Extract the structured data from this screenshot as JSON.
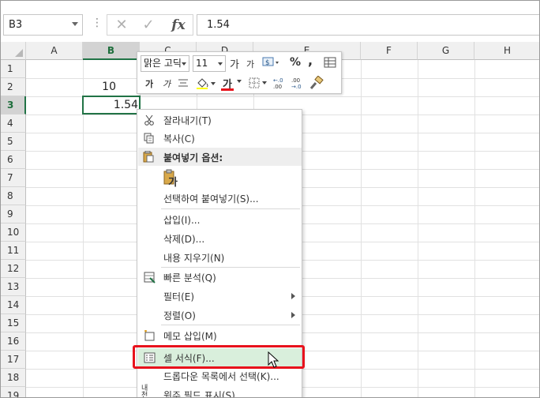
{
  "formula_bar": {
    "name_box": "B3",
    "dots": "⋮",
    "cancel_glyph": "✕",
    "enter_glyph": "✓",
    "fx_label": "fx",
    "formula_value": "1.54"
  },
  "grid": {
    "columns": [
      "A",
      "B",
      "C",
      "D",
      "E",
      "F",
      "G",
      "H"
    ],
    "rows": [
      "1",
      "2",
      "3",
      "4",
      "5",
      "6",
      "7",
      "8",
      "9",
      "10",
      "11",
      "12",
      "13",
      "14",
      "15",
      "16",
      "17",
      "18",
      "19"
    ],
    "selected_column": "B",
    "selected_row": "3",
    "cell_b2": "10",
    "cell_b3": "1.54"
  },
  "mini_toolbar": {
    "font_name": "맑은 고딕",
    "font_size": "11",
    "grow_font": "가",
    "shrink_font": "가",
    "percent": "%",
    "comma": ",",
    "bold": "가",
    "italic": "가",
    "font_color_glyph": "가",
    "inc_decimal": "←.0 .00",
    "dec_decimal": ".00 →.0"
  },
  "context_menu": {
    "cut": "잘라내기(T)",
    "copy": "복사(C)",
    "paste_options": "붙여넣기 옵션:",
    "paste_glyph": "가",
    "paste_special": "선택하여 붙여넣기(S)...",
    "insert": "삽입(I)...",
    "delete": "삭제(D)...",
    "clear_contents": "내용 지우기(N)",
    "quick_analysis": "빠른 분석(Q)",
    "filter": "필터(E)",
    "sort": "정렬(O)",
    "insert_comment": "메모 삽입(M)",
    "format_cells": "셀 서식(F)...",
    "pick_from_list": "드롭다운 목록에서 선택(K)...",
    "phonetic": "윗주 필드 표시(S)",
    "phonetic_icon": "내천"
  },
  "colors": {
    "accent": "#217346",
    "highlight_border": "#e8121c",
    "hover_fill": "#d9efdc"
  }
}
